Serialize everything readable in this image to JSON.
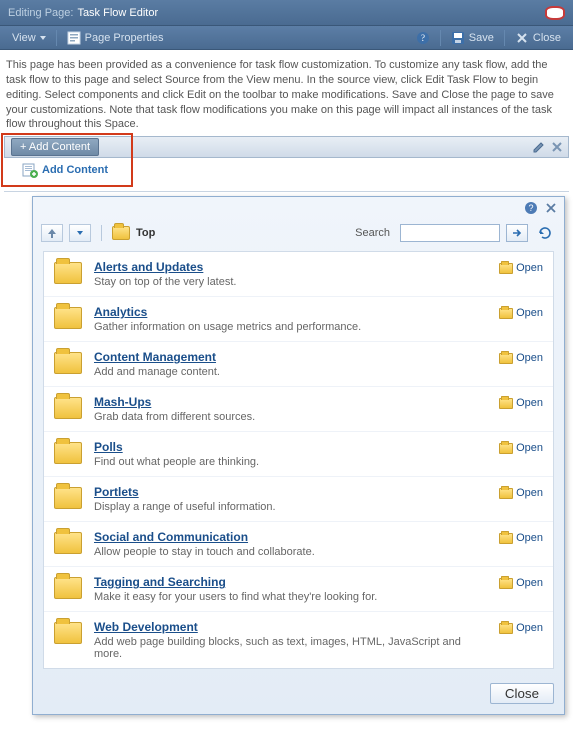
{
  "pageHeader": {
    "label": "Editing Page:",
    "title": "Task Flow Editor"
  },
  "toolbar": {
    "viewMenu": "View",
    "pageProperties": "Page Properties",
    "save": "Save",
    "close": "Close"
  },
  "intro": "This page has been provided as a convenience for task flow customization. To customize any task flow, add the task flow to this page and select Source from the View menu. In the source view, click Edit Task Flow to begin editing. Select components and click Edit on the toolbar to make modifications. Save and Close the page to save your customizations. Note that task flow modifications you make on this page will impact all instances of the task flow throughout this Space.",
  "composer": {
    "addContentBtn": "+ Add Content"
  },
  "preview": {
    "addContentLink": "Add Content"
  },
  "dialog": {
    "breadcrumb": "Top",
    "searchLabel": "Search",
    "closeBtn": "Close",
    "openLabel": "Open"
  },
  "catalog": [
    {
      "title": "Alerts and Updates",
      "desc": "Stay on top of the very latest."
    },
    {
      "title": "Analytics",
      "desc": "Gather information on usage metrics and performance."
    },
    {
      "title": "Content Management",
      "desc": "Add and manage content."
    },
    {
      "title": "Mash-Ups",
      "desc": "Grab data from different sources."
    },
    {
      "title": "Polls",
      "desc": "Find out what people are thinking."
    },
    {
      "title": "Portlets",
      "desc": "Display a range of useful information."
    },
    {
      "title": "Social and Communication",
      "desc": "Allow people to stay in touch and collaborate."
    },
    {
      "title": "Tagging and Searching",
      "desc": "Make it easy for your users to find what they're looking for."
    },
    {
      "title": "Web Development",
      "desc": "Add web page building blocks, such as text, images, HTML, JavaScript and more."
    }
  ]
}
